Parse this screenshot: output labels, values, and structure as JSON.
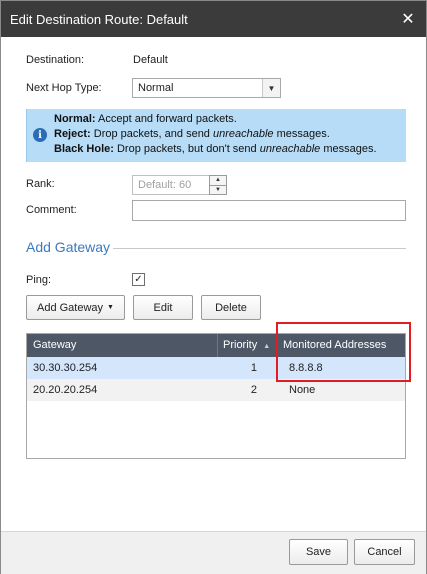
{
  "dialog": {
    "title": "Edit Destination Route: Default",
    "close_glyph": "✕"
  },
  "form": {
    "destination_label": "Destination:",
    "destination_value": "Default",
    "next_hop_label": "Next Hop Type:",
    "next_hop_value": "Normal",
    "rank_label": "Rank:",
    "rank_placeholder": "Default: 60",
    "comment_label": "Comment:",
    "comment_value": ""
  },
  "info": {
    "icon": "info-icon",
    "normal_term": "Normal:",
    "normal_desc": " Accept and forward packets.",
    "reject_term": "Reject:",
    "reject_desc_1": " Drop packets, and send ",
    "reject_em": "unreachable",
    "reject_desc_2": " messages.",
    "blackhole_term": "Black Hole:",
    "blackhole_desc_1": " Drop packets, but don't send ",
    "blackhole_em": "unreachable",
    "blackhole_desc_2": " messages."
  },
  "gateway_section": {
    "title": "Add Gateway",
    "ping_label": "Ping:",
    "ping_checked": true,
    "ping_check_glyph": "✓",
    "add_button": "Add Gateway",
    "edit_button": "Edit",
    "delete_button": "Delete"
  },
  "grid": {
    "columns": [
      "Gateway",
      "Priority",
      "Monitored Addresses"
    ],
    "sort_glyph": "▲",
    "rows": [
      {
        "gateway": "30.30.30.254",
        "priority": "1",
        "monitored": "8.8.8.8",
        "selected": true
      },
      {
        "gateway": "20.20.20.254",
        "priority": "2",
        "monitored": "None",
        "selected": false
      }
    ]
  },
  "footer": {
    "save": "Save",
    "cancel": "Cancel"
  },
  "colors": {
    "titlebar": "#3b3b3b",
    "info_bg": "#b7dcf7",
    "grid_header": "#4d5766",
    "selected_row": "#d3e6fb",
    "highlight": "#e21c23",
    "section_title": "#3a7ac0"
  }
}
